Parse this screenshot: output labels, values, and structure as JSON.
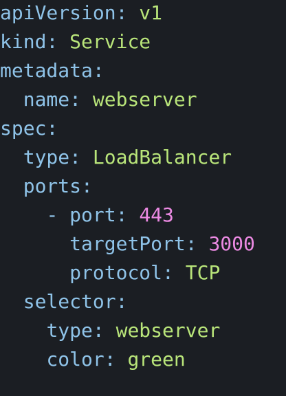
{
  "colors": {
    "background": "#1b1e23",
    "key": "#8fc3e8",
    "string": "#b9e57a",
    "number": "#ec8ae3"
  },
  "yaml": {
    "apiVersion": {
      "key": "apiVersion",
      "value": "v1"
    },
    "kind": {
      "key": "kind",
      "value": "Service"
    },
    "metadata": {
      "key": "metadata"
    },
    "metadata_name": {
      "key": "name",
      "value": "webserver"
    },
    "spec": {
      "key": "spec"
    },
    "spec_type": {
      "key": "type",
      "value": "LoadBalancer"
    },
    "ports": {
      "key": "ports"
    },
    "port_dash": "-",
    "port": {
      "key": "port",
      "value": "443"
    },
    "targetPort": {
      "key": "targetPort",
      "value": "3000"
    },
    "protocol": {
      "key": "protocol",
      "value": "TCP"
    },
    "selector": {
      "key": "selector"
    },
    "selector_type": {
      "key": "type",
      "value": "webserver"
    },
    "selector_color": {
      "key": "color",
      "value": "green"
    }
  },
  "punct": {
    "colon": ":"
  }
}
